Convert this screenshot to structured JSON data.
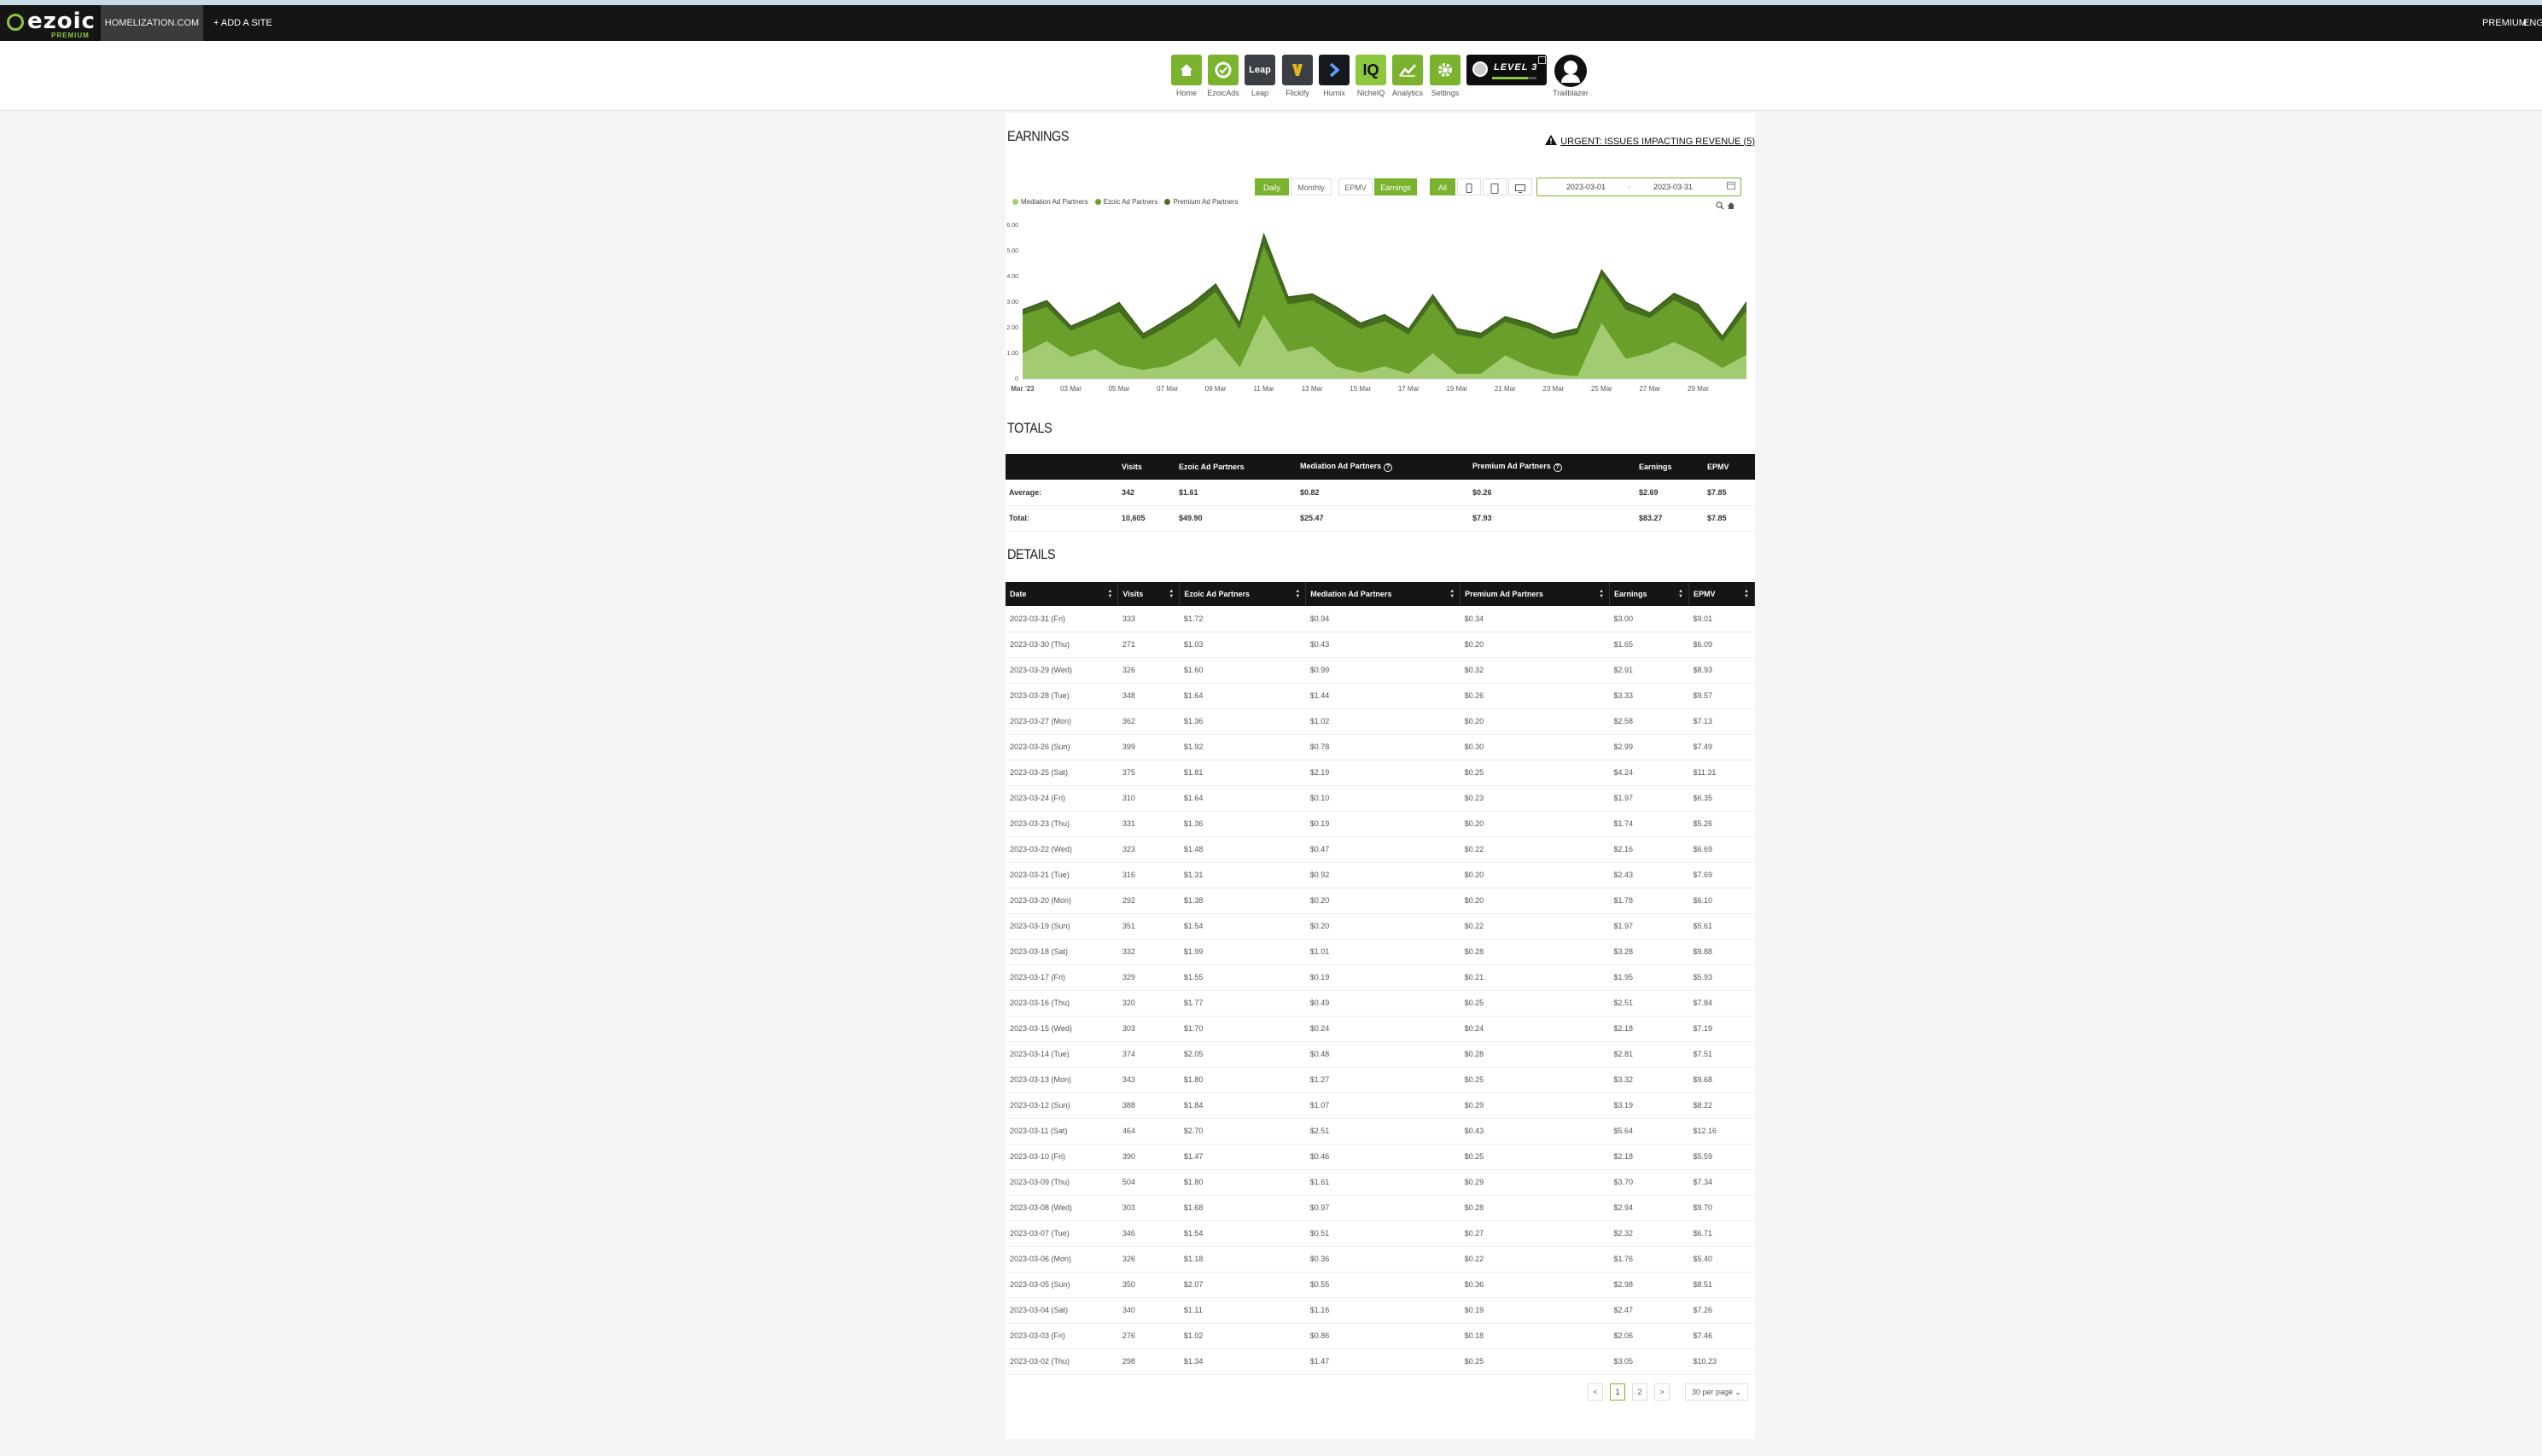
{
  "topbar": {
    "logo_text": "ezoic",
    "logo_sub": "PREMIUM",
    "site": "HOMELIZATION.COM",
    "add_site": "+ ADD A SITE",
    "premium": "PREMIUM",
    "lang": "ENGL"
  },
  "apps": [
    {
      "label": "Home",
      "icon": "home-icon"
    },
    {
      "label": "EzoicAds",
      "icon": "ezoicads-icon"
    },
    {
      "label": "Leap",
      "icon": "leap-icon",
      "tile_text": "Leap"
    },
    {
      "label": "Flickify",
      "icon": "flickify-icon"
    },
    {
      "label": "Humix",
      "icon": "humix-icon"
    },
    {
      "label": "NicheIQ",
      "icon": "nicheiq-icon",
      "tile_text": "IQ"
    },
    {
      "label": "Analytics",
      "icon": "analytics-icon"
    },
    {
      "label": "Settings",
      "icon": "gear-icon"
    }
  ],
  "level": {
    "text": "LEVEL 3",
    "progress": 0.8
  },
  "trailblazer": {
    "label": "Trailblazer"
  },
  "earnings": {
    "title": "EARNINGS",
    "urgent": "URGENT: ISSUES IMPACTING REVENUE (5)",
    "buttons": {
      "daily": "Daily",
      "monthly": "Monthly",
      "epmv": "EPMV",
      "earnings": "Earnings",
      "all": "All"
    },
    "date_from": "2023-03-01",
    "date_to": "2023-03-31",
    "date_sep": "-"
  },
  "colors": {
    "brand": "#7bb32e",
    "dark": "#151515",
    "light_area": "#a3cc72",
    "mid_area": "#6a9f2c",
    "dark_area": "#466e1f"
  },
  "chart_data": {
    "type": "area",
    "stacked": true,
    "x": [
      "2023-03-01",
      "2023-03-02",
      "2023-03-03",
      "2023-03-04",
      "2023-03-05",
      "2023-03-06",
      "2023-03-07",
      "2023-03-08",
      "2023-03-09",
      "2023-03-10",
      "2023-03-11",
      "2023-03-12",
      "2023-03-13",
      "2023-03-14",
      "2023-03-15",
      "2023-03-16",
      "2023-03-17",
      "2023-03-18",
      "2023-03-19",
      "2023-03-20",
      "2023-03-21",
      "2023-03-22",
      "2023-03-23",
      "2023-03-24",
      "2023-03-25",
      "2023-03-26",
      "2023-03-27",
      "2023-03-28",
      "2023-03-29",
      "2023-03-30",
      "2023-03-31"
    ],
    "x_tick_labels": [
      "Mar '23",
      "03 Mar",
      "05 Mar",
      "07 Mar",
      "09 Mar",
      "11 Mar",
      "13 Mar",
      "15 Mar",
      "17 Mar",
      "19 Mar",
      "21 Mar",
      "23 Mar",
      "25 Mar",
      "27 Mar",
      "29 Mar"
    ],
    "y_tick_labels": [
      "0",
      "1.00",
      "2.00",
      "3.00",
      "4.00",
      "5.00",
      "6.00"
    ],
    "ylim": [
      0,
      6
    ],
    "series": [
      {
        "name": "Mediation Ad Partners",
        "color": "#a3cc72",
        "values": [
          1.0,
          1.47,
          0.86,
          1.16,
          0.55,
          0.36,
          0.51,
          0.97,
          1.61,
          0.46,
          2.51,
          1.07,
          1.27,
          0.48,
          0.24,
          0.49,
          0.19,
          1.01,
          0.2,
          0.2,
          0.92,
          0.47,
          0.19,
          0.1,
          2.19,
          0.78,
          1.02,
          1.44,
          0.99,
          0.43,
          0.94
        ]
      },
      {
        "name": "Ezoic Ad Partners",
        "color": "#6a9f2c",
        "values": [
          1.5,
          1.34,
          1.02,
          1.11,
          2.07,
          1.18,
          1.54,
          1.68,
          1.8,
          1.47,
          2.7,
          1.84,
          1.8,
          2.05,
          1.7,
          1.77,
          1.55,
          1.99,
          1.54,
          1.38,
          1.31,
          1.48,
          1.36,
          1.64,
          1.81,
          1.92,
          1.36,
          1.64,
          1.6,
          1.03,
          1.72
        ]
      },
      {
        "name": "Premium Ad Partners",
        "color": "#466e1f",
        "values": [
          0.2,
          0.25,
          0.18,
          0.19,
          0.36,
          0.22,
          0.27,
          0.28,
          0.29,
          0.25,
          0.43,
          0.29,
          0.25,
          0.28,
          0.24,
          0.25,
          0.21,
          0.28,
          0.22,
          0.2,
          0.2,
          0.22,
          0.2,
          0.23,
          0.25,
          0.3,
          0.2,
          0.26,
          0.32,
          0.2,
          0.34
        ]
      }
    ],
    "grid": false,
    "legend": "top-left"
  },
  "totals": {
    "title": "TOTALS",
    "headers": [
      "",
      "Visits",
      "Ezoic Ad Partners",
      "Mediation Ad Partners",
      "Premium Ad Partners",
      "Earnings",
      "EPMV"
    ],
    "rows": [
      [
        "Average:",
        "342",
        "$1.61",
        "$0.82",
        "$0.26",
        "$2.69",
        "$7.85"
      ],
      [
        "Total:",
        "10,605",
        "$49.90",
        "$25.47",
        "$7.93",
        "$83.27",
        "$7.85"
      ]
    ]
  },
  "details": {
    "title": "DETAILS",
    "headers": [
      "Date",
      "Visits",
      "Ezoic Ad Partners",
      "Mediation Ad Partners",
      "Premium Ad Partners",
      "Earnings",
      "EPMV"
    ],
    "rows": [
      [
        "2023-03-31 (Fri)",
        "333",
        "$1.72",
        "$0.94",
        "$0.34",
        "$3.00",
        "$9.01"
      ],
      [
        "2023-03-30 (Thu)",
        "271",
        "$1.03",
        "$0.43",
        "$0.20",
        "$1.65",
        "$6.09"
      ],
      [
        "2023-03-29 (Wed)",
        "326",
        "$1.60",
        "$0.99",
        "$0.32",
        "$2.91",
        "$8.93"
      ],
      [
        "2023-03-28 (Tue)",
        "348",
        "$1.64",
        "$1.44",
        "$0.26",
        "$3.33",
        "$9.57"
      ],
      [
        "2023-03-27 (Mon)",
        "362",
        "$1.36",
        "$1.02",
        "$0.20",
        "$2.58",
        "$7.13"
      ],
      [
        "2023-03-26 (Sun)",
        "399",
        "$1.92",
        "$0.78",
        "$0.30",
        "$2.99",
        "$7.49"
      ],
      [
        "2023-03-25 (Sat)",
        "375",
        "$1.81",
        "$2.19",
        "$0.25",
        "$4.24",
        "$11.31"
      ],
      [
        "2023-03-24 (Fri)",
        "310",
        "$1.64",
        "$0.10",
        "$0.23",
        "$1.97",
        "$6.35"
      ],
      [
        "2023-03-23 (Thu)",
        "331",
        "$1.36",
        "$0.19",
        "$0.20",
        "$1.74",
        "$5.26"
      ],
      [
        "2023-03-22 (Wed)",
        "323",
        "$1.48",
        "$0.47",
        "$0.22",
        "$2.16",
        "$6.69"
      ],
      [
        "2023-03-21 (Tue)",
        "316",
        "$1.31",
        "$0.92",
        "$0.20",
        "$2.43",
        "$7.69"
      ],
      [
        "2023-03-20 (Mon)",
        "292",
        "$1.38",
        "$0.20",
        "$0.20",
        "$1.78",
        "$6.10"
      ],
      [
        "2023-03-19 (Sun)",
        "351",
        "$1.54",
        "$0.20",
        "$0.22",
        "$1.97",
        "$5.61"
      ],
      [
        "2023-03-18 (Sat)",
        "332",
        "$1.99",
        "$1.01",
        "$0.28",
        "$3.28",
        "$9.88"
      ],
      [
        "2023-03-17 (Fri)",
        "329",
        "$1.55",
        "$0.19",
        "$0.21",
        "$1.95",
        "$5.93"
      ],
      [
        "2023-03-16 (Thu)",
        "320",
        "$1.77",
        "$0.49",
        "$0.25",
        "$2.51",
        "$7.84"
      ],
      [
        "2023-03-15 (Wed)",
        "303",
        "$1.70",
        "$0.24",
        "$0.24",
        "$2.18",
        "$7.19"
      ],
      [
        "2023-03-14 (Tue)",
        "374",
        "$2.05",
        "$0.48",
        "$0.28",
        "$2.81",
        "$7.51"
      ],
      [
        "2023-03-13 (Mon)",
        "343",
        "$1.80",
        "$1.27",
        "$0.25",
        "$3.32",
        "$9.68"
      ],
      [
        "2023-03-12 (Sun)",
        "388",
        "$1.84",
        "$1.07",
        "$0.29",
        "$3.19",
        "$8.22"
      ],
      [
        "2023-03-11 (Sat)",
        "464",
        "$2.70",
        "$2.51",
        "$0.43",
        "$5.64",
        "$12.16"
      ],
      [
        "2023-03-10 (Fri)",
        "390",
        "$1.47",
        "$0.46",
        "$0.25",
        "$2.18",
        "$5.59"
      ],
      [
        "2023-03-09 (Thu)",
        "504",
        "$1.80",
        "$1.61",
        "$0.29",
        "$3.70",
        "$7.34"
      ],
      [
        "2023-03-08 (Wed)",
        "303",
        "$1.68",
        "$0.97",
        "$0.28",
        "$2.94",
        "$9.70"
      ],
      [
        "2023-03-07 (Tue)",
        "346",
        "$1.54",
        "$0.51",
        "$0.27",
        "$2.32",
        "$6.71"
      ],
      [
        "2023-03-06 (Mon)",
        "326",
        "$1.18",
        "$0.36",
        "$0.22",
        "$1.76",
        "$5.40"
      ],
      [
        "2023-03-05 (Sun)",
        "350",
        "$2.07",
        "$0.55",
        "$0.36",
        "$2.98",
        "$8.51"
      ],
      [
        "2023-03-04 (Sat)",
        "340",
        "$1.11",
        "$1.16",
        "$0.19",
        "$2.47",
        "$7.26"
      ],
      [
        "2023-03-03 (Fri)",
        "276",
        "$1.02",
        "$0.86",
        "$0.18",
        "$2.06",
        "$7.46"
      ],
      [
        "2023-03-02 (Thu)",
        "298",
        "$1.34",
        "$1.47",
        "$0.25",
        "$3.05",
        "$10.23"
      ]
    ]
  },
  "pagination": {
    "prev": "<",
    "pages": [
      "1",
      "2"
    ],
    "next": ">",
    "per_page": "30 per page"
  }
}
